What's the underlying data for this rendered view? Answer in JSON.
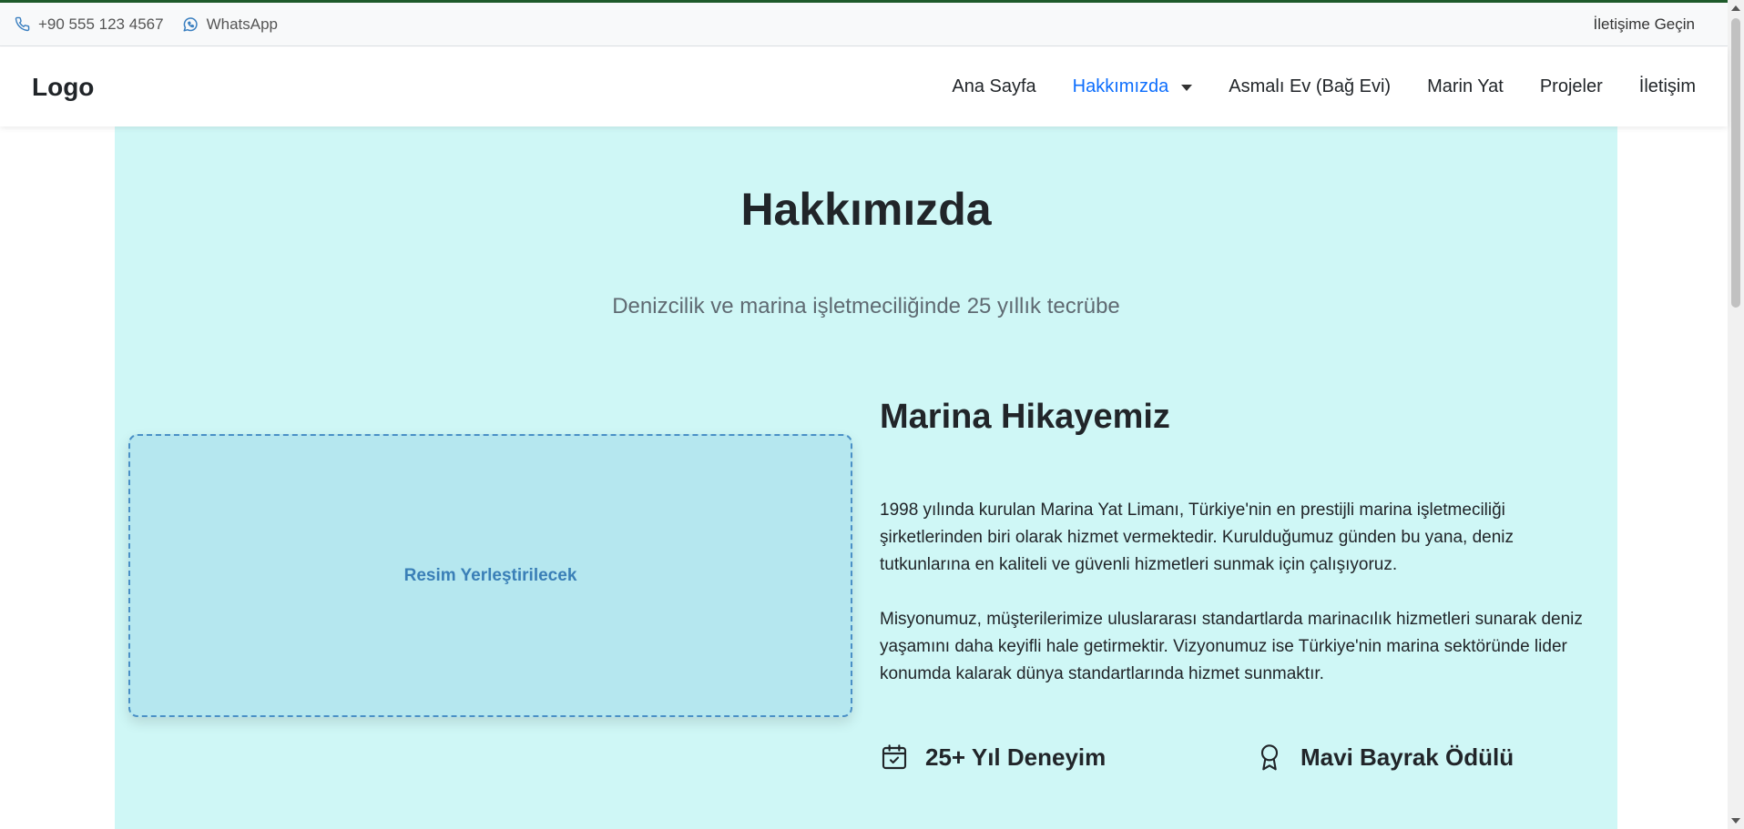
{
  "topbar": {
    "phone": "+90 555 123 4567",
    "whatsapp": "WhatsApp",
    "contact": "İletişime Geçin"
  },
  "navbar": {
    "logo": "Logo",
    "items": [
      {
        "label": "Ana Sayfa"
      },
      {
        "label": "Hakkımızda"
      },
      {
        "label": "Asmalı Ev (Bağ Evi)"
      },
      {
        "label": "Marin Yat"
      },
      {
        "label": "Projeler"
      },
      {
        "label": "İletişim"
      }
    ]
  },
  "hero": {
    "title": "Hakkımızda",
    "subtitle": "Denizcilik ve marina işletmeciliğinde 25 yıllık tecrübe"
  },
  "story": {
    "image_placeholder": "Resim Yerleştirilecek",
    "title": "Marina Hikayemiz",
    "paragraph1": "1998 yılında kurulan Marina Yat Limanı, Türkiye'nin en prestijli marina işletmeciliği şirketlerinden biri olarak hizmet vermektedir. Kurulduğumuz günden bu yana, deniz tutkunlarına en kaliteli ve güvenli hizmetleri sunmak için çalışıyoruz.",
    "paragraph2": "Misyonumuz, müşterilerimize uluslararası standartlarda marinacılık hizmetleri sunarak deniz yaşamını daha keyifli hale getirmektir. Vizyonumuz ise Türkiye'nin marina sektöründe lider konumda kalarak dünya standartlarında hizmet sunmaktır."
  },
  "features": [
    {
      "label": "25+ Yıl Deneyim",
      "icon": "calendar-check-icon"
    },
    {
      "label": "Mavi Bayrak Ödülü",
      "icon": "award-icon"
    }
  ],
  "colors": {
    "accent": "#0d6efd",
    "section_bg": "#cff7f6",
    "placeholder_bg": "#b5e7ef",
    "top_border": "#1e5a2a"
  }
}
